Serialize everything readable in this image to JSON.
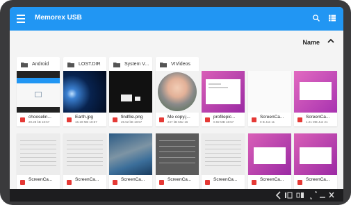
{
  "app": {
    "title": "Memorex USB"
  },
  "sort": {
    "label": "Name"
  },
  "folders": [
    {
      "name": "Android"
    },
    {
      "name": "LOST.DIR"
    },
    {
      "name": "System V..."
    },
    {
      "name": "VIVideos"
    }
  ],
  "files_row1": [
    {
      "name": "chooselin...",
      "meta": "20.28 kB 18:57"
    },
    {
      "name": "Earth.jpg",
      "meta": "16.19 MB 18:57"
    },
    {
      "name": "findfile.png",
      "meta": "25.52 kB 18:57"
    },
    {
      "name": "Me copy.j...",
      "meta": "247 kB Mar 16"
    },
    {
      "name": "profilepic...",
      "meta": "0.92 MB 18:57"
    },
    {
      "name": "ScreenCa...",
      "meta": "0 B Jun 11"
    },
    {
      "name": "ScreenCa...",
      "meta": "1.21 MB Jun 21"
    }
  ],
  "files_row2": [
    {
      "name": "ScreenCa..."
    },
    {
      "name": "ScreenCa..."
    },
    {
      "name": "ScreenCa..."
    },
    {
      "name": "ScreenCa..."
    },
    {
      "name": "ScreenCa..."
    },
    {
      "name": "ScreenCa..."
    },
    {
      "name": "ScreenCa..."
    }
  ],
  "colors": {
    "accent": "#2196f3",
    "file_icon": "#e53935",
    "purple": "#b23bb0"
  },
  "icons": {
    "menu": "menu-icon",
    "search": "search-icon",
    "view": "grid-view-icon",
    "sort": "chevron-up-icon",
    "folder": "folder-icon",
    "image_file": "image-file-icon"
  }
}
